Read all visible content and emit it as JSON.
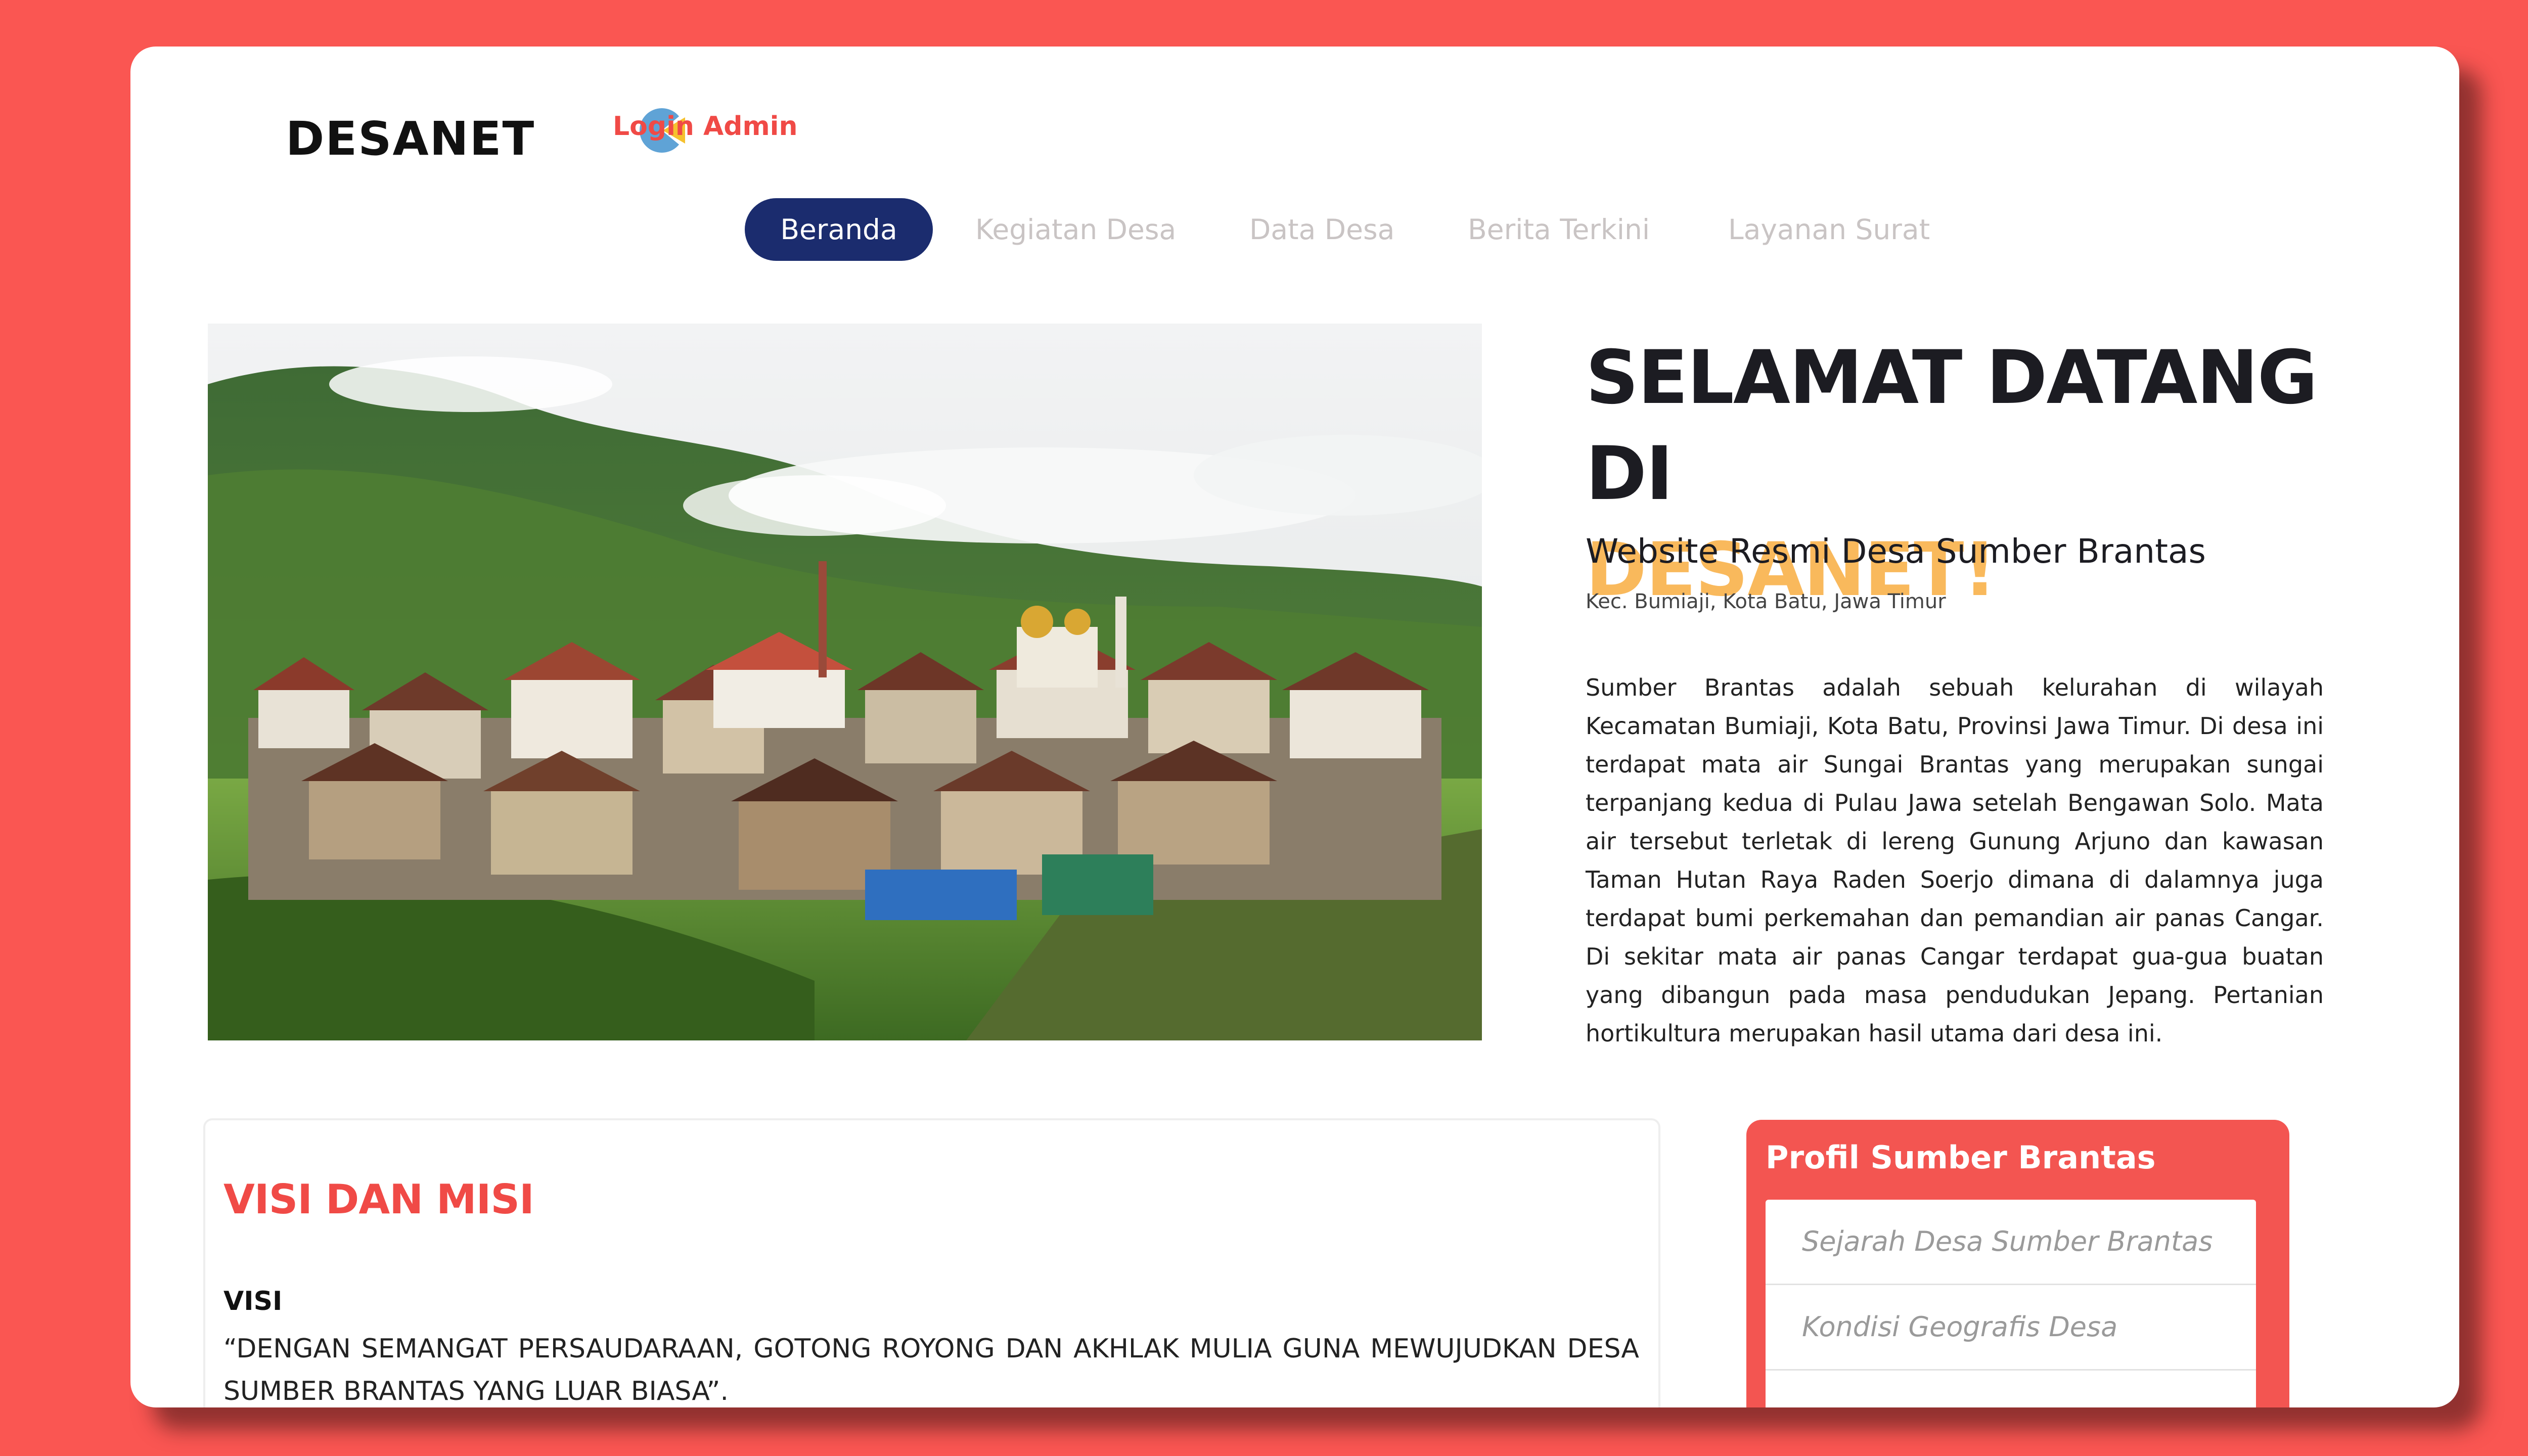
{
  "header": {
    "logo_text": "DESANET",
    "login_label": "Login Admin"
  },
  "nav": {
    "items": [
      "Beranda",
      "Kegiatan Desa",
      "Data Desa",
      "Berita Terkini",
      "Layanan Surat"
    ],
    "active_index": 0
  },
  "hero": {
    "title_line1": "SELAMAT DATANG DI",
    "title_line2": "DESANET!",
    "subtitle": "Website Resmi Desa Sumber Brantas",
    "location": "Kec. Bumiaji, Kota Batu, Jawa Timur",
    "description": "Sumber Brantas adalah sebuah kelurahan di wilayah Kecamatan Bumiaji, Kota Batu, Provinsi Jawa Timur. Di desa ini terdapat mata air Sungai Brantas yang merupakan sungai terpanjang kedua di Pulau Jawa setelah Bengawan Solo. Mata air tersebut terletak di lereng Gunung Arjuno dan kawasan Taman Hutan Raya Raden Soerjo dimana di dalamnya juga terdapat bumi perkemahan dan pemandian air panas Cangar. Di sekitar mata air panas Cangar terdapat gua-gua buatan yang dibangun pada masa pendudukan Jepang. Pertanian hortikultura merupakan hasil utama dari desa ini."
  },
  "visi_misi": {
    "heading": "VISI DAN MISI",
    "visi_label": "VISI",
    "visi_text": "“DENGAN SEMANGAT PERSAUDARAAN, GOTONG ROYONG DAN AKHLAK MULIA GUNA MEWUJUDKAN DESA SUMBER BRANTAS YANG LUAR BIASA”."
  },
  "profil": {
    "title": "Profil Sumber Brantas",
    "items": [
      "Sejarah Desa Sumber Brantas",
      "Kondisi Geografis Desa",
      ""
    ]
  },
  "colors": {
    "background": "#fa5652",
    "nav_active": "#1b2c6e",
    "accent_yellow": "#f9b95c",
    "accent_red": "#f04a46"
  },
  "icons": {
    "logo_mark": "pie-logo-icon"
  }
}
